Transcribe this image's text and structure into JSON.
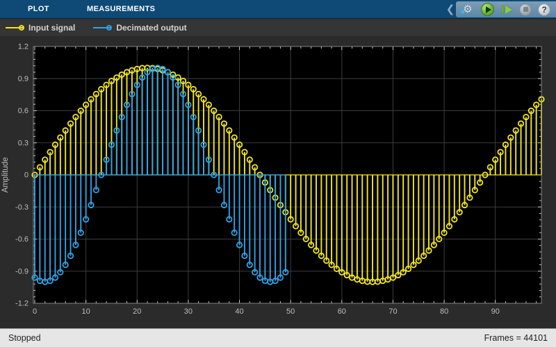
{
  "toolstrip": {
    "tabs": [
      {
        "label": "PLOT"
      },
      {
        "label": "MEASUREMENTS"
      }
    ],
    "chevron_glyph": "❮",
    "gear_glyph": "⚙",
    "help_glyph": "?",
    "colors": {
      "bar": "#0e4a75",
      "panel": "#6f94b2"
    }
  },
  "legend": {
    "items": [
      {
        "label": "Input signal",
        "color": "#f2e722"
      },
      {
        "label": "Decimated output",
        "color": "#2fa3e6"
      }
    ]
  },
  "status_bar": {
    "left": "Stopped",
    "right": "Frames = 44101"
  },
  "chart_data": {
    "type": "stem",
    "title": "",
    "xlabel": "",
    "ylabel": "Amplitude",
    "xlim": [
      0,
      99
    ],
    "ylim": [
      -1.2,
      1.2
    ],
    "xticks": [
      0,
      10,
      20,
      30,
      40,
      50,
      60,
      70,
      80,
      90
    ],
    "x_minor_step": 2,
    "yticks": [
      -1.2,
      -0.9,
      -0.6,
      -0.3,
      0,
      0.3,
      0.6,
      0.9,
      1.2
    ],
    "y_minor_step": 0.06,
    "grid": true,
    "background": "#000000",
    "grid_color": "#3d3d3d",
    "axis_border_color": "#848484",
    "tick_color": "#c8c8c8",
    "tick_label_color": "#bdbdbd",
    "legend_position": "top-left-strip",
    "series": [
      {
        "name": "Input signal",
        "color": "#f2e722",
        "x_start": 0,
        "x_step": 1,
        "values": [
          0,
          0.071,
          0.142,
          0.213,
          0.282,
          0.349,
          0.415,
          0.479,
          0.541,
          0.599,
          0.655,
          0.707,
          0.756,
          0.801,
          0.841,
          0.878,
          0.91,
          0.937,
          0.96,
          0.977,
          0.99,
          0.998,
          1,
          0.998,
          0.99,
          0.977,
          0.96,
          0.937,
          0.91,
          0.878,
          0.841,
          0.801,
          0.756,
          0.707,
          0.655,
          0.599,
          0.541,
          0.479,
          0.415,
          0.349,
          0.282,
          0.213,
          0.142,
          0.071,
          0,
          -0.071,
          -0.142,
          -0.213,
          -0.282,
          -0.349,
          -0.415,
          -0.479,
          -0.541,
          -0.599,
          -0.655,
          -0.707,
          -0.756,
          -0.801,
          -0.841,
          -0.878,
          -0.91,
          -0.937,
          -0.96,
          -0.977,
          -0.99,
          -0.998,
          -1,
          -0.998,
          -0.99,
          -0.977,
          -0.96,
          -0.937,
          -0.91,
          -0.878,
          -0.841,
          -0.801,
          -0.756,
          -0.707,
          -0.655,
          -0.599,
          -0.541,
          -0.479,
          -0.415,
          -0.349,
          -0.282,
          -0.213,
          -0.142,
          -0.071,
          0,
          0.071,
          0.142,
          0.213,
          0.282,
          0.349,
          0.415,
          0.479,
          0.541,
          0.599,
          0.655,
          0.707
        ]
      },
      {
        "name": "Decimated output",
        "color": "#2fa3e6",
        "x_start": 0,
        "x_step": 1,
        "values": [
          -0.96,
          -0.99,
          -1,
          -0.99,
          -0.96,
          -0.91,
          -0.841,
          -0.756,
          -0.655,
          -0.541,
          -0.415,
          -0.282,
          -0.142,
          0,
          0.142,
          0.282,
          0.415,
          0.541,
          0.655,
          0.756,
          0.841,
          0.91,
          0.96,
          0.99,
          1,
          0.99,
          0.96,
          0.91,
          0.841,
          0.756,
          0.655,
          0.541,
          0.415,
          0.282,
          0.142,
          0,
          -0.142,
          -0.282,
          -0.415,
          -0.541,
          -0.655,
          -0.756,
          -0.841,
          -0.91,
          -0.96,
          -0.99,
          -1,
          -0.99,
          -0.96,
          -0.91
        ]
      }
    ]
  }
}
